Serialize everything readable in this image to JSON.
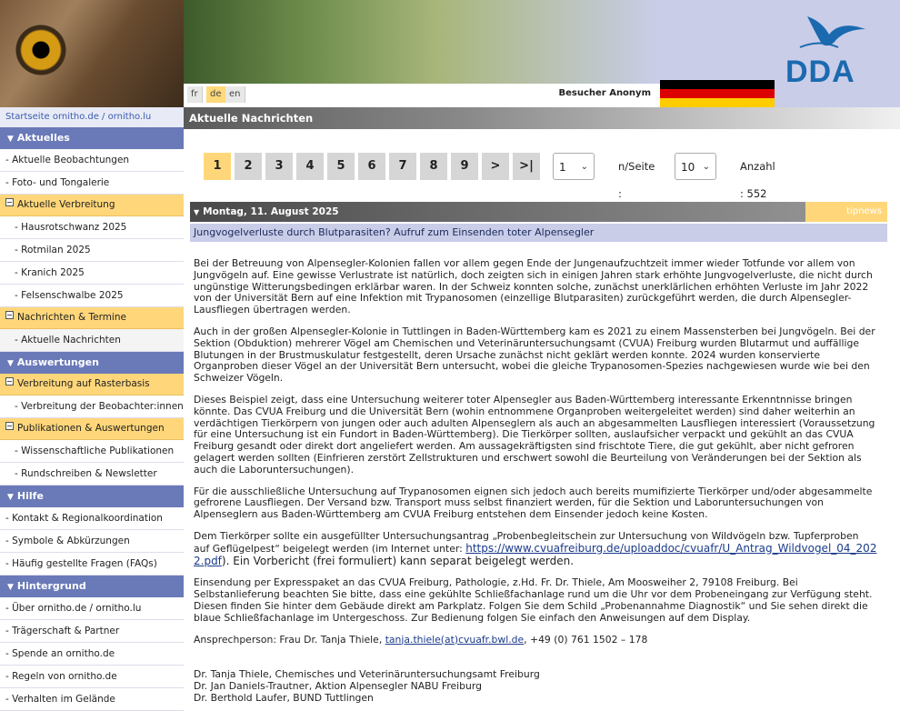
{
  "header": {
    "logo_text": "DDA",
    "languages": [
      {
        "code": "fr",
        "active": false
      },
      {
        "code": "de",
        "active": true
      },
      {
        "code": "en",
        "active": false
      }
    ],
    "visitor": "Besucher Anonym"
  },
  "sidebar": {
    "breadcrumb": "Startseite ornitho.de / ornitho.lu",
    "sections": {
      "aktuelles": "Aktuelles",
      "auswertungen": "Auswertungen",
      "hilfe": "Hilfe",
      "hintergrund": "Hintergrund"
    },
    "items": {
      "aktuelle_beobachtungen": "- Aktuelle Beobachtungen",
      "foto_tongalerie": "- Foto- und Tongalerie",
      "aktuelle_verbreitung": "Aktuelle Verbreitung",
      "hausrotschwanz": "- Hausrotschwanz 2025",
      "rotmilan": "- Rotmilan 2025",
      "kranich": "- Kranich 2025",
      "felsenschwalbe": "- Felsenschwalbe 2025",
      "nachrichten_termine": "Nachrichten & Termine",
      "aktuelle_nachrichten": "- Aktuelle Nachrichten",
      "verbreitung_raster": "Verbreitung auf Rasterbasis",
      "verbreitung_beobachter": "- Verbreitung der Beobachter:innen",
      "publikationen": "Publikationen & Auswertungen",
      "wissenschaftliche": "- Wissenschaftliche Publikationen",
      "rundschreiben": "- Rundschreiben & Newsletter",
      "kontakt": "- Kontakt & Regionalkoordination",
      "symbole": "- Symbole & Abkürzungen",
      "faq": "- Häufig gestellte Fragen (FAQs)",
      "ueber": "- Über ornitho.de / ornitho.lu",
      "traegerschaft": "- Trägerschaft & Partner",
      "spende": "- Spende an ornitho.de",
      "regeln": "- Regeln von ornitho.de",
      "verhalten": "- Verhalten im Gelände"
    }
  },
  "main": {
    "title": "Aktuelle Nachrichten",
    "pager": {
      "pages": [
        "1",
        "2",
        "3",
        "4",
        "5",
        "6",
        "7",
        "8",
        "9",
        ">",
        ">|"
      ],
      "active_page": "1",
      "select_value": "1",
      "per_page_label": "n/Seite :",
      "per_page_value": "10",
      "count_label": "Anzahl : 552"
    },
    "date": "Montag, 11. August 2025",
    "source": "tipnews",
    "headline": "Jungvogelverluste durch Blutparasiten? Aufruf zum Einsenden toter Alpensegler",
    "paragraphs": [
      "Bei der Betreuung von Alpensegler-Kolonien fallen vor allem gegen Ende der Jungenaufzuchtzeit immer wieder Totfunde vor allem von Jungvögeln auf. Eine gewisse Verlustrate ist natürlich, doch zeigten sich in einigen Jahren stark erhöhte Jungvogelverluste, die nicht durch ungünstige Witterungsbedingen erklärbar waren. In der Schweiz konnten solche, zunächst unerklärlichen erhöhten Verluste im Jahr 2022 von der Universität Bern auf eine Infektion mit Trypanosomen (einzellige Blutparasiten) zurückgeführt werden, die durch Alpensegler-Lausfliegen übertragen werden.",
      "Auch in der großen Alpensegler-Kolonie in Tuttlingen in Baden-Württemberg kam es 2021 zu einem Massensterben bei Jungvögeln. Bei der Sektion (Obduktion) mehrerer Vögel am Chemischen und Veterinäruntersuchungsamt (CVUA) Freiburg wurden Blutarmut und auffällige Blutungen in der Brustmuskulatur festgestellt, deren Ursache zunächst nicht geklärt werden konnte. 2024 wurden konservierte Organproben dieser Vögel an der Universität Bern untersucht, wobei die gleiche Trypanosomen-Spezies nachgewiesen wurde wie bei den Schweizer Vögeln.",
      "Dieses Beispiel zeigt, dass eine Untersuchung weiterer toter Alpensegler aus Baden-Württemberg interessante Erkenntnnisse bringen könnte. Das CVUA Freiburg und die Universität Bern (wohin entnommene Organproben weitergeleitet werden) sind daher weiterhin an verdächtigen Tierkörpern von jungen oder auch adulten Alpenseglern als auch an abgesammelten Lausfliegen interessiert (Voraussetzung für eine Untersuchung ist ein Fundort in Baden-Württemberg). Die Tierkörper sollten, auslaufsicher verpackt und gekühlt an das CVUA Freiburg gesandt oder direkt dort angeliefert werden. Am aussagekräftigsten sind frischtote Tiere, die gut gekühlt, aber nicht gefroren gelagert werden sollten (Einfrieren zerstört Zellstrukturen und erschwert sowohl die Beurteilung von Veränderungen bei der Sektion als auch die Laboruntersuchungen).",
      "Für die ausschließliche Untersuchung auf Trypanosomen eignen sich jedoch auch bereits mumifizierte Tierkörper und/oder abgesammelte gefrorene Lausfliegen. Der Versand bzw. Transport muss selbst finanziert werden, für die Sektion und Laboruntersuchungen von Alpenseglern aus Baden-Württemberg am CVUA Freiburg entstehen dem Einsender jedoch keine Kosten."
    ],
    "p5_before": "Dem Tierkörper sollte ein ausgefüllter Untersuchungsantrag „Probenbegleitschein zur Untersuchung von Wildvögeln bzw. Tupferproben auf Geflügelpest“ beigelegt werden (im Internet unter: ",
    "p5_link": "https://www.cvuafreiburg.de/uploaddoc/cvuafr/U_Antrag_Wildvogel_04_2022.pdf",
    "p5_after": "). Ein Vorbericht (frei formuliert) kann separat beigelegt werden.",
    "p6": "Einsendung per Expresspaket an das CVUA Freiburg, Pathologie, z.Hd. Fr. Dr. Thiele, Am Moosweiher 2, 79108 Freiburg. Bei Selbstanlieferung beachten Sie bitte, dass eine gekühlte Schließfachanlage rund um die Uhr vor dem Probeneingang zur Verfügung steht. Diesen finden Sie hinter dem Gebäude direkt am Parkplatz. Folgen Sie dem Schild „Probenannahme Diagnostik“ und Sie sehen direkt die blaue Schließfachanlage im Untergeschoss. Zur Bedienung folgen Sie einfach den Anweisungen auf dem Display.",
    "contact_before": "Ansprechperson: Frau Dr. Tanja Thiele, ",
    "contact_email": "tanja.thiele(at)cvuafr.bwl.de",
    "contact_after": ", +49 (0) 761 1502 – 178",
    "signatures": [
      "Dr. Tanja Thiele, Chemisches und Veterinäruntersuchungsamt Freiburg",
      "Dr. Jan Daniels-Trautner, Aktion Alpensegler NABU Freiburg",
      "Dr. Berthold Laufer, BUND Tuttlingen"
    ]
  }
}
